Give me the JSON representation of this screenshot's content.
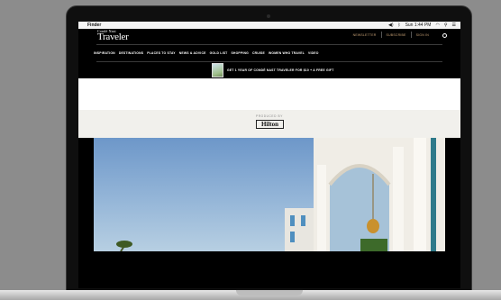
{
  "menubar": {
    "app_name": "Finder",
    "clock": "Sun 1:44 PM"
  },
  "site": {
    "logo_top": "Condé Nast",
    "logo_main": "Traveler",
    "top_links": [
      "NEWSLETTER",
      "SUBSCRIBE",
      "SIGN IN"
    ],
    "nav": [
      "INSPIRATION",
      "DESTINATIONS",
      "PLACES TO STAY",
      "NEWS & ADVICE",
      "GOLD LIST",
      "SHOPPING",
      "CRUISE",
      "WOMEN WHO TRAVEL",
      "VIDEO"
    ],
    "promo_text": "GET 1 YEAR OF CONDÉ NAST TRAVELER FOR $10 + A FREE GIFT",
    "sponsor_label": "PRODUCED BY",
    "sponsor_name": "Hilton"
  },
  "colors": {
    "link_gold": "#c8a276",
    "sky": "#6d97c9",
    "building": "#f0ede6"
  }
}
